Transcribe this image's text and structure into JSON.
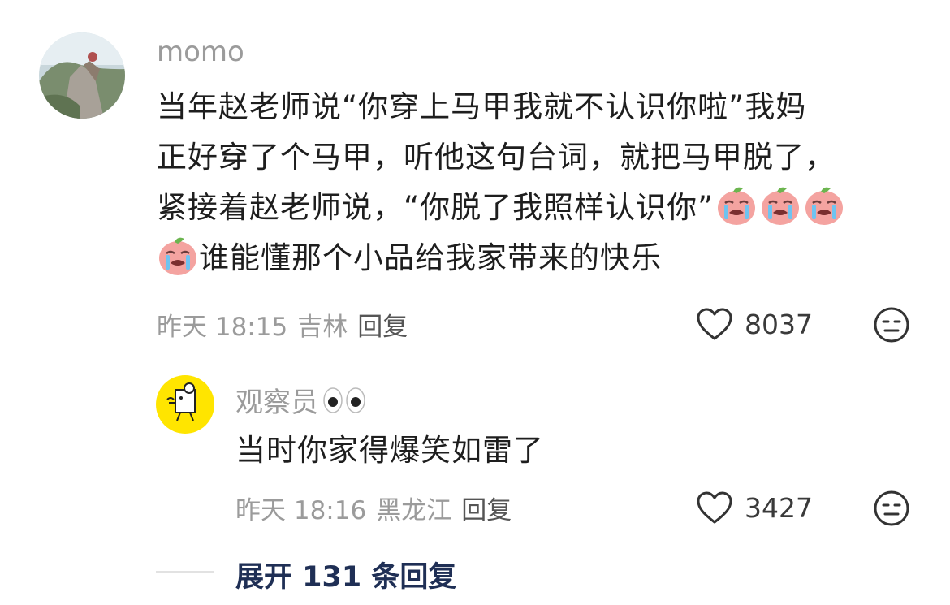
{
  "comments": [
    {
      "username": "momo",
      "text_lines": [
        "当年赵老师说“你穿上马甲我就不认识你啦”我妈",
        "正好穿了个马甲，听他这句台词，就把马甲脱了，",
        "紧接着赵老师说，“你脱了我照样认识你”",
        "谁能懂那个小品给我家带来的快乐"
      ],
      "emoji_icon": "crying-face-emoji-icon",
      "time": "昨天 18:15",
      "location": "吉林",
      "reply_label": "回复",
      "likes": "8037"
    },
    {
      "username": "观察员",
      "username_icon": "eyes-emoji-icon",
      "text": "当时你家得爆笑如雷了",
      "time": "昨天 18:16",
      "location": "黑龙江",
      "reply_label": "回复",
      "likes": "3427"
    }
  ],
  "expand_label": "展开 131 条回复",
  "colors": {
    "meta": "#9b9b9b",
    "expand": "#1f2f55",
    "avatar2_bg": "#ffe500"
  }
}
